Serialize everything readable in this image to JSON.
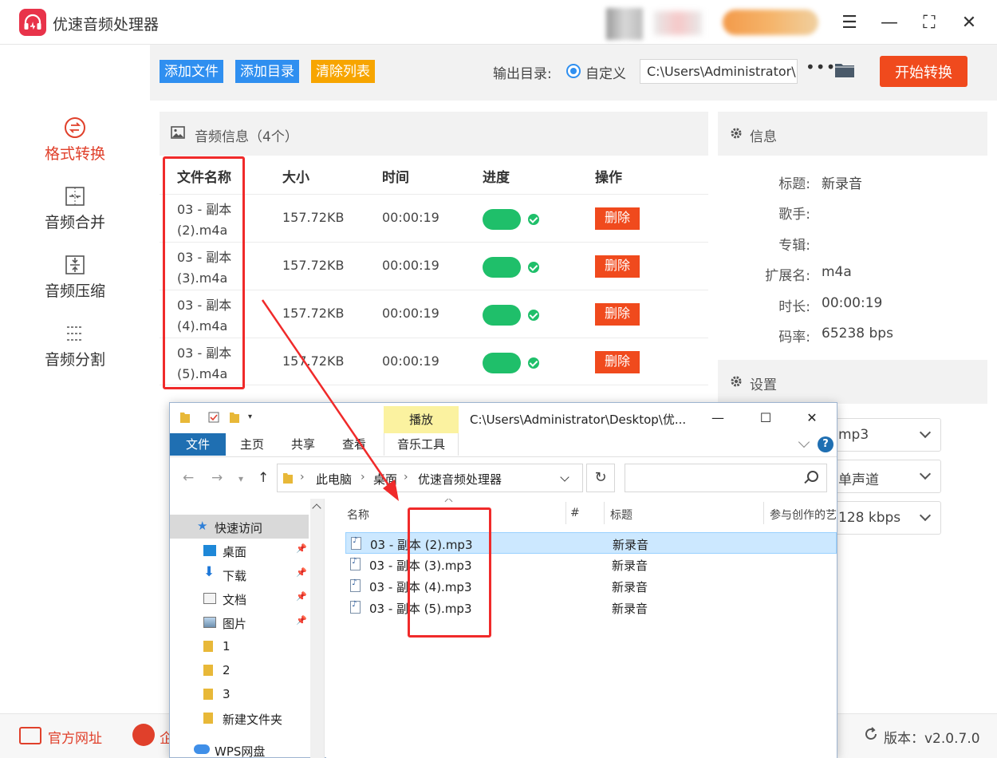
{
  "app": {
    "title": "优速音频处理器",
    "window_controls": {
      "menu": "☰",
      "minimize": "—",
      "maximize": "⛶",
      "close": "✕"
    }
  },
  "sidebar": {
    "items": [
      {
        "label": "格式转换",
        "icon": "format-convert-icon",
        "active": true
      },
      {
        "label": "音频合并",
        "icon": "merge-icon",
        "active": false
      },
      {
        "label": "音频压缩",
        "icon": "compress-icon",
        "active": false
      },
      {
        "label": "音频分割",
        "icon": "split-icon",
        "active": false
      }
    ]
  },
  "toolbar": {
    "add_file": "添加文件",
    "add_dir": "添加目录",
    "clear_list": "清除列表",
    "output_label": "输出目录:",
    "custom_label": "自定义",
    "output_path": "C:\\Users\\Administrator\\",
    "more": "•••",
    "start": "开始转换"
  },
  "audio_list": {
    "header": "音频信息（4个）",
    "columns": {
      "name": "文件名称",
      "size": "大小",
      "time": "时间",
      "progress": "进度",
      "action": "操作"
    },
    "rows": [
      {
        "name": "03 - 副本 (2).m4a",
        "size": "157.72KB",
        "time": "00:00:19",
        "progress": 1.0,
        "action": "删除"
      },
      {
        "name": "03 - 副本 (3).m4a",
        "size": "157.72KB",
        "time": "00:00:19",
        "progress": 1.0,
        "action": "删除"
      },
      {
        "name": "03 - 副本 (4).m4a",
        "size": "157.72KB",
        "time": "00:00:19",
        "progress": 1.0,
        "action": "删除"
      },
      {
        "name": "03 - 副本 (5).m4a",
        "size": "157.72KB",
        "time": "00:00:19",
        "progress": 1.0,
        "action": "删除"
      }
    ]
  },
  "info": {
    "header": "信息",
    "rows": [
      {
        "key": "标题:",
        "value": "新录音"
      },
      {
        "key": "歌手:",
        "value": ""
      },
      {
        "key": "专辑:",
        "value": ""
      },
      {
        "key": "扩展名:",
        "value": "m4a"
      },
      {
        "key": "时长:",
        "value": "00:00:19"
      },
      {
        "key": "码率:",
        "value": "65238 bps"
      }
    ]
  },
  "settings": {
    "header": "设置",
    "format_value": "mp3",
    "channel_value": "单声道",
    "bitrate_value": "128 kbps"
  },
  "footer": {
    "site": "官方网址",
    "qq": "企",
    "version": "版本：v2.0.7.0"
  },
  "explorer": {
    "title": "C:\\Users\\Administrator\\Desktop\\优...",
    "context_tab": "播放",
    "tabs": [
      "文件",
      "主页",
      "共享",
      "查看",
      "音乐工具"
    ],
    "breadcrumb": [
      "此电脑",
      "桌面",
      "优速音频处理器"
    ],
    "nav": [
      {
        "label": "快速访问",
        "selected": true,
        "pinned": false
      },
      {
        "label": "桌面",
        "selected": false,
        "pinned": true
      },
      {
        "label": "下载",
        "selected": false,
        "pinned": true
      },
      {
        "label": "文档",
        "selected": false,
        "pinned": true
      },
      {
        "label": "图片",
        "selected": false,
        "pinned": true
      },
      {
        "label": "1",
        "selected": false,
        "pinned": false
      },
      {
        "label": "2",
        "selected": false,
        "pinned": false
      },
      {
        "label": "3",
        "selected": false,
        "pinned": false
      },
      {
        "label": "新建文件夹",
        "selected": false,
        "pinned": false
      },
      {
        "label": "WPS网盘",
        "selected": false,
        "pinned": false
      }
    ],
    "columns": {
      "name": "名称",
      "num": "#",
      "title": "标题",
      "artists": "参与创作的艺"
    },
    "files": [
      {
        "name": "03 - 副本 (2).mp3",
        "title": "新录音",
        "selected": true
      },
      {
        "name": "03 - 副本 (3).mp3",
        "title": "新录音",
        "selected": false
      },
      {
        "name": "03 - 副本 (4).mp3",
        "title": "新录音",
        "selected": false
      },
      {
        "name": "03 - 副本 (5).mp3",
        "title": "新录音",
        "selected": false
      }
    ]
  },
  "colors": {
    "accent_red": "#f04a1d",
    "brand_blue": "#2f8ff0",
    "progress_green": "#1fbf6a",
    "annotation_red": "#f02a2a"
  }
}
